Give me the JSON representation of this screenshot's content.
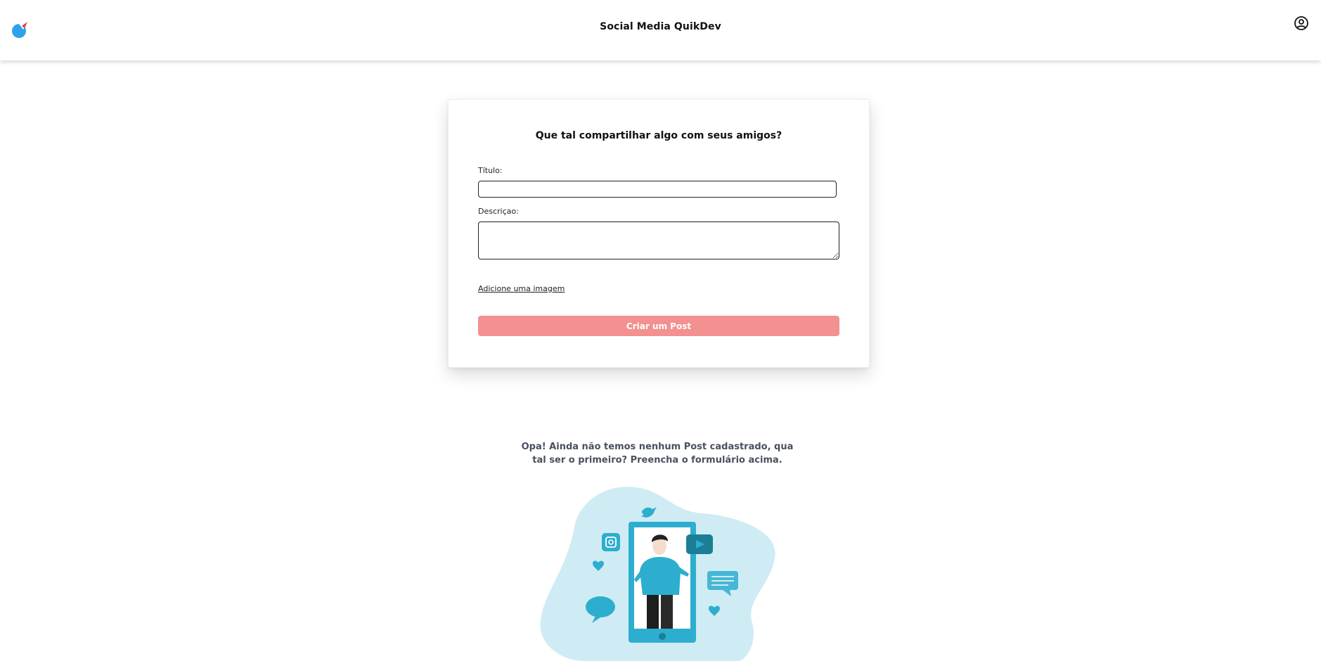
{
  "header": {
    "title": "Social Media QuikDev",
    "logo_icon": "quikdev-logo-icon",
    "user_icon": "user-circle-icon"
  },
  "form": {
    "heading": "Que tal compartilhar algo com seus amigos?",
    "title_label": "Título:",
    "title_value": "",
    "description_label": "Descriçao:",
    "description_value": "",
    "add_image_label": "Adicione uma imagem",
    "submit_label": "Criar um Post",
    "submit_color": "#f39090"
  },
  "empty_state": {
    "message": "Opa! Ainda não temos nenhum Post cadastrado, qua tal ser o primeiro? Preencha o formulário acima.",
    "illustration_icon": "social-media-illustration-icon",
    "accent_color": "#2eaecf",
    "blob_color": "#cfecf4"
  }
}
